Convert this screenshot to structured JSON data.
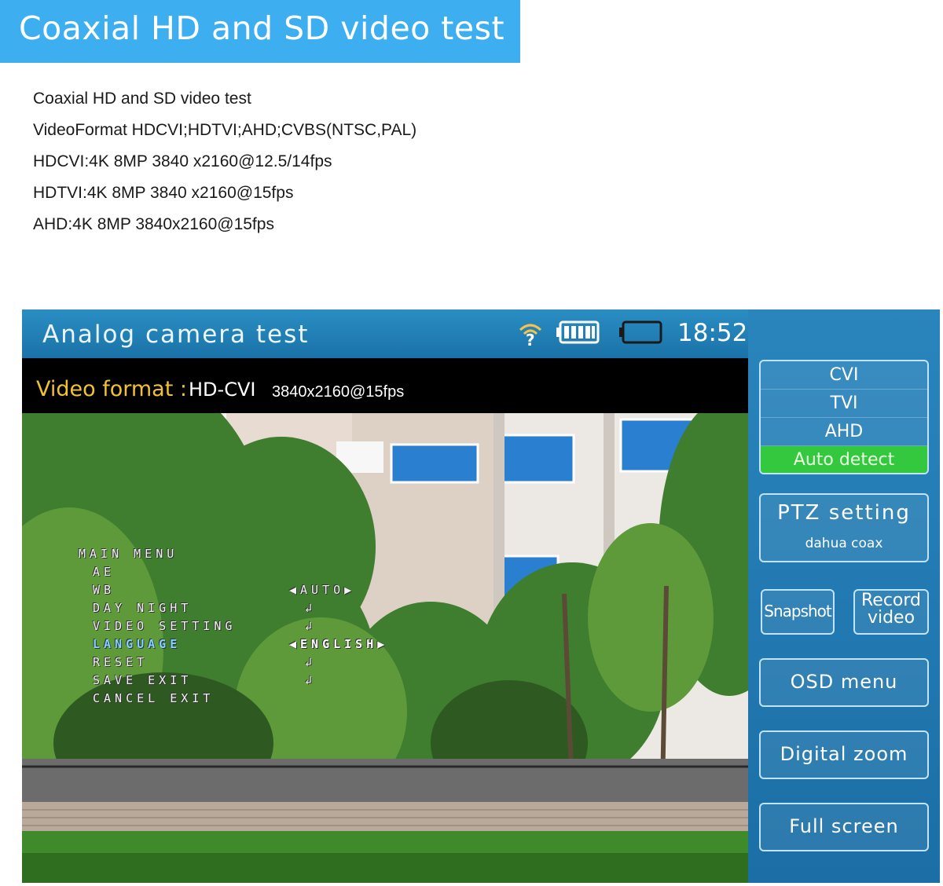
{
  "banner": {
    "title": "Coaxial HD and SD video test"
  },
  "specs": [
    "Coaxial HD and SD video test",
    "VideoFormat HDCVI;HDTVI;AHD;CVBS(NTSC,PAL)",
    "HDCVI:4K 8MP 3840 x2160@12.5/14fps",
    "HDTVI:4K 8MP 3840 x2160@15fps",
    "AHD:4K 8MP 3840x2160@15fps"
  ],
  "device": {
    "title": "Analog camera test",
    "clock": "18:52",
    "format_label": "Video format :",
    "format_value": "HD-CVI",
    "format_resolution": "3840x2160@15fps",
    "icons": [
      "wifi-icon",
      "battery-full-icon",
      "battery-empty-icon"
    ],
    "osd": {
      "items": [
        "MAIN MENU",
        "AE",
        "WB",
        "DAY NIGHT",
        "VIDEO SETTING",
        "LANGUAGE",
        "RESET",
        "SAVE EXIT",
        "CANCEL EXIT"
      ],
      "values": [
        "",
        "",
        "◀AUTO▶",
        "↲",
        "↲",
        "◀ENGLISH▶",
        "↲",
        "↲",
        ""
      ],
      "active_index": 5
    },
    "modes": [
      "CVI",
      "TVI",
      "AHD",
      "Auto detect"
    ],
    "selected_mode": "Auto detect",
    "ptz": {
      "title": "PTZ setting",
      "subtitle": "dahua coax"
    },
    "snapshot_label": "Snapshot",
    "record_label_1": "Record",
    "record_label_2": "video",
    "osd_menu_label": "OSD menu",
    "digital_zoom_label": "Digital zoom",
    "full_screen_label": "Full screen",
    "colors": {
      "banner": "#3daeef",
      "topbar": "#1f7fb6",
      "format_label": "#f1c232",
      "selected_mode": "#34c83f",
      "panel": "#2a85bd"
    }
  }
}
